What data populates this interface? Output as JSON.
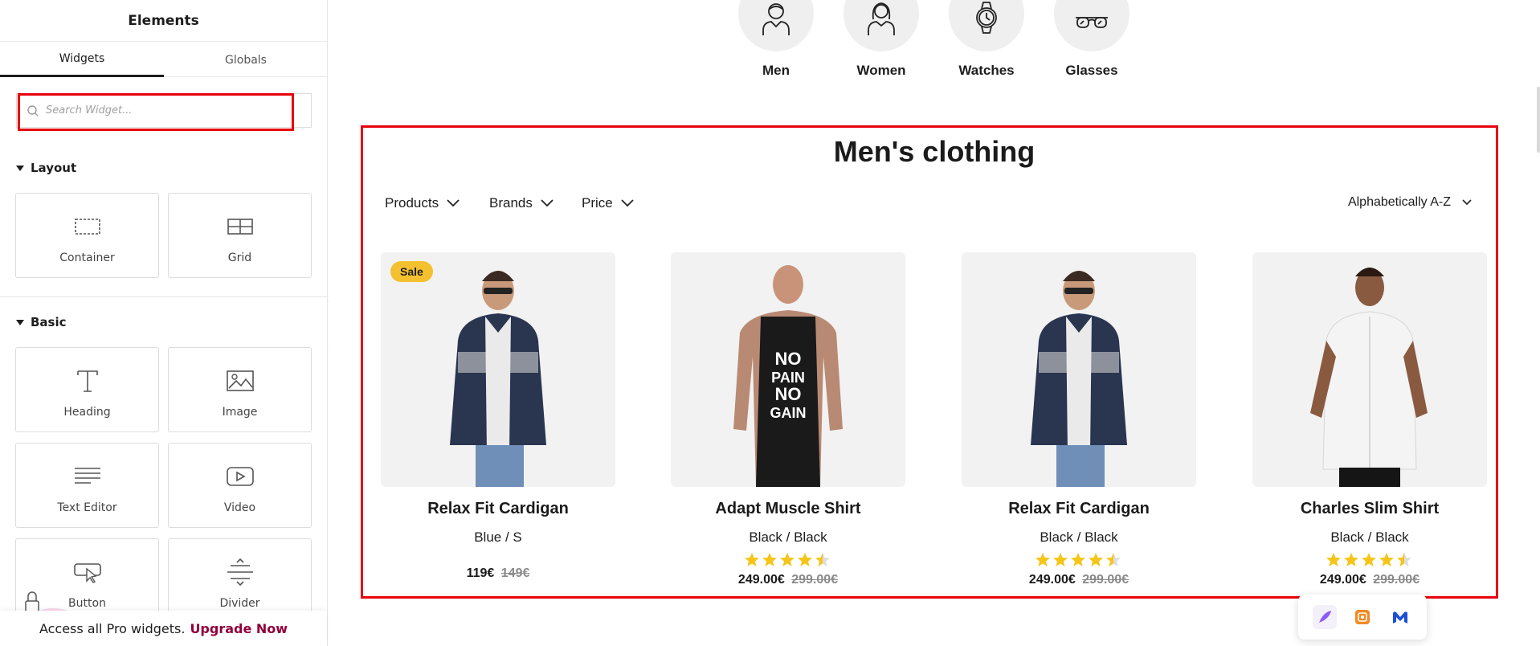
{
  "sidebar": {
    "title": "Elements",
    "tabs": [
      {
        "label": "Widgets",
        "active": true
      },
      {
        "label": "Globals",
        "active": false
      }
    ],
    "search_placeholder": "Search Widget...",
    "sections": [
      {
        "label": "Layout",
        "widgets": [
          {
            "label": "Container",
            "icon": "container-icon"
          },
          {
            "label": "Grid",
            "icon": "grid-icon"
          }
        ]
      },
      {
        "label": "Basic",
        "widgets": [
          {
            "label": "Heading",
            "icon": "heading-icon"
          },
          {
            "label": "Image",
            "icon": "image-icon"
          },
          {
            "label": "Text Editor",
            "icon": "text-editor-icon"
          },
          {
            "label": "Video",
            "icon": "video-icon"
          },
          {
            "label": "Button",
            "icon": "button-icon"
          },
          {
            "label": "Divider",
            "icon": "divider-icon"
          }
        ]
      }
    ],
    "promo": {
      "text": "Access all Pro widgets.",
      "link": "Upgrade Now"
    }
  },
  "canvas": {
    "categories": [
      {
        "label": "Men",
        "icon": "man-icon"
      },
      {
        "label": "Women",
        "icon": "woman-icon"
      },
      {
        "label": "Watches",
        "icon": "watch-icon"
      },
      {
        "label": "Glasses",
        "icon": "glasses-icon"
      }
    ],
    "title": "Men's clothing",
    "filters": [
      "Products",
      "Brands",
      "Price"
    ],
    "sort": "Alphabetically A-Z",
    "products": [
      {
        "name": "Relax Fit Cardigan",
        "variant": "Blue / S",
        "price": "119€",
        "old_price": "149€",
        "sale_badge": "Sale",
        "rating": null
      },
      {
        "name": "Adapt Muscle Shirt",
        "variant": "Black / Black",
        "price": "249.00€",
        "old_price": "299.00€",
        "sale_badge": null,
        "rating": 4.5
      },
      {
        "name": "Relax Fit Cardigan",
        "variant": "Black / Black",
        "price": "249.00€",
        "old_price": "299.00€",
        "sale_badge": null,
        "rating": 4.5
      },
      {
        "name": "Charles Slim Shirt",
        "variant": "Black / Black",
        "price": "249.00€",
        "old_price": "299.00€",
        "sale_badge": null,
        "rating": 4.5
      }
    ]
  },
  "colors": {
    "highlight": "#e8000c",
    "sale": "#f3c12f",
    "star": "#f5c518",
    "upgrade": "#92003b"
  }
}
